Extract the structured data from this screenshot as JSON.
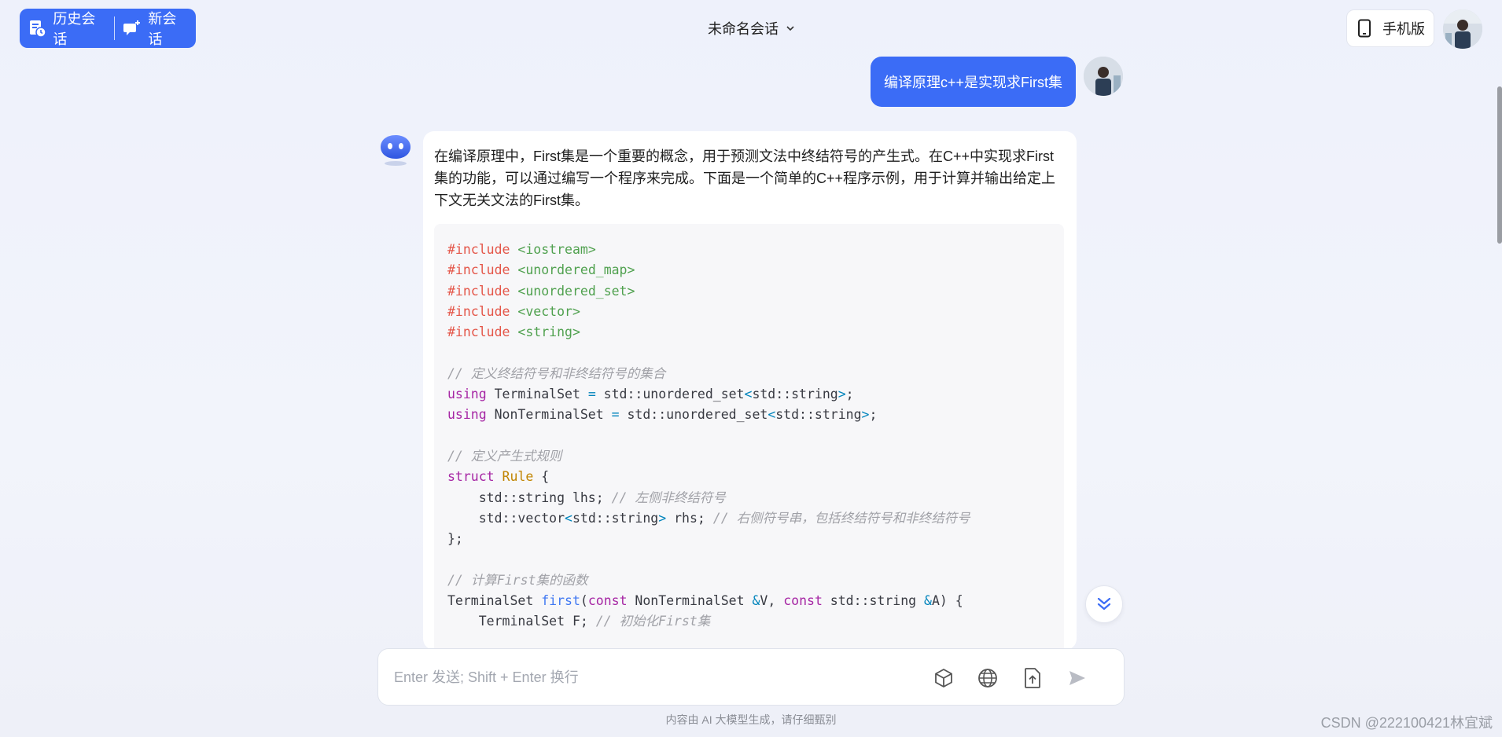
{
  "header": {
    "history_label": "历史会话",
    "new_chat_label": "新会话",
    "conversation_title": "未命名会话",
    "mobile_label": "手机版",
    "accent_color": "#3b6cf6"
  },
  "messages": {
    "user_text": "编译原理c++是实现求First集",
    "bot_intro": "在编译原理中，First集是一个重要的概念，用于预测文法中终结符号的产生式。在C++中实现求First集的功能，可以通过编写一个程序来完成。下面是一个简单的C++程序示例，用于计算并输出给定上下文无关文法的First集。",
    "code_lines": [
      "#include <iostream>",
      "#include <unordered_map>",
      "#include <unordered_set>",
      "#include <vector>",
      "#include <string>",
      "",
      "// 定义终结符号和非终结符号的集合",
      "using TerminalSet = std::unordered_set<std::string>;",
      "using NonTerminalSet = std::unordered_set<std::string>;",
      "",
      "// 定义产生式规则",
      "struct Rule {",
      "    std::string lhs; // 左侧非终结符号",
      "    std::vector<std::string> rhs; // 右侧符号串，包括终结符号和非终结符号",
      "};",
      "",
      "// 计算First集的函数",
      "TerminalSet first(const NonTerminalSet &V, const std::string &A) {",
      "    TerminalSet F; // 初始化First集"
    ]
  },
  "composer": {
    "placeholder": "Enter 发送; Shift + Enter 换行",
    "tools": [
      "cube-icon",
      "globe-icon",
      "file-upload-icon",
      "send-icon"
    ]
  },
  "footer": {
    "disclaimer": "内容由 AI 大模型生成，请仔细甄别",
    "watermark": "CSDN @222100421林宜斌"
  }
}
